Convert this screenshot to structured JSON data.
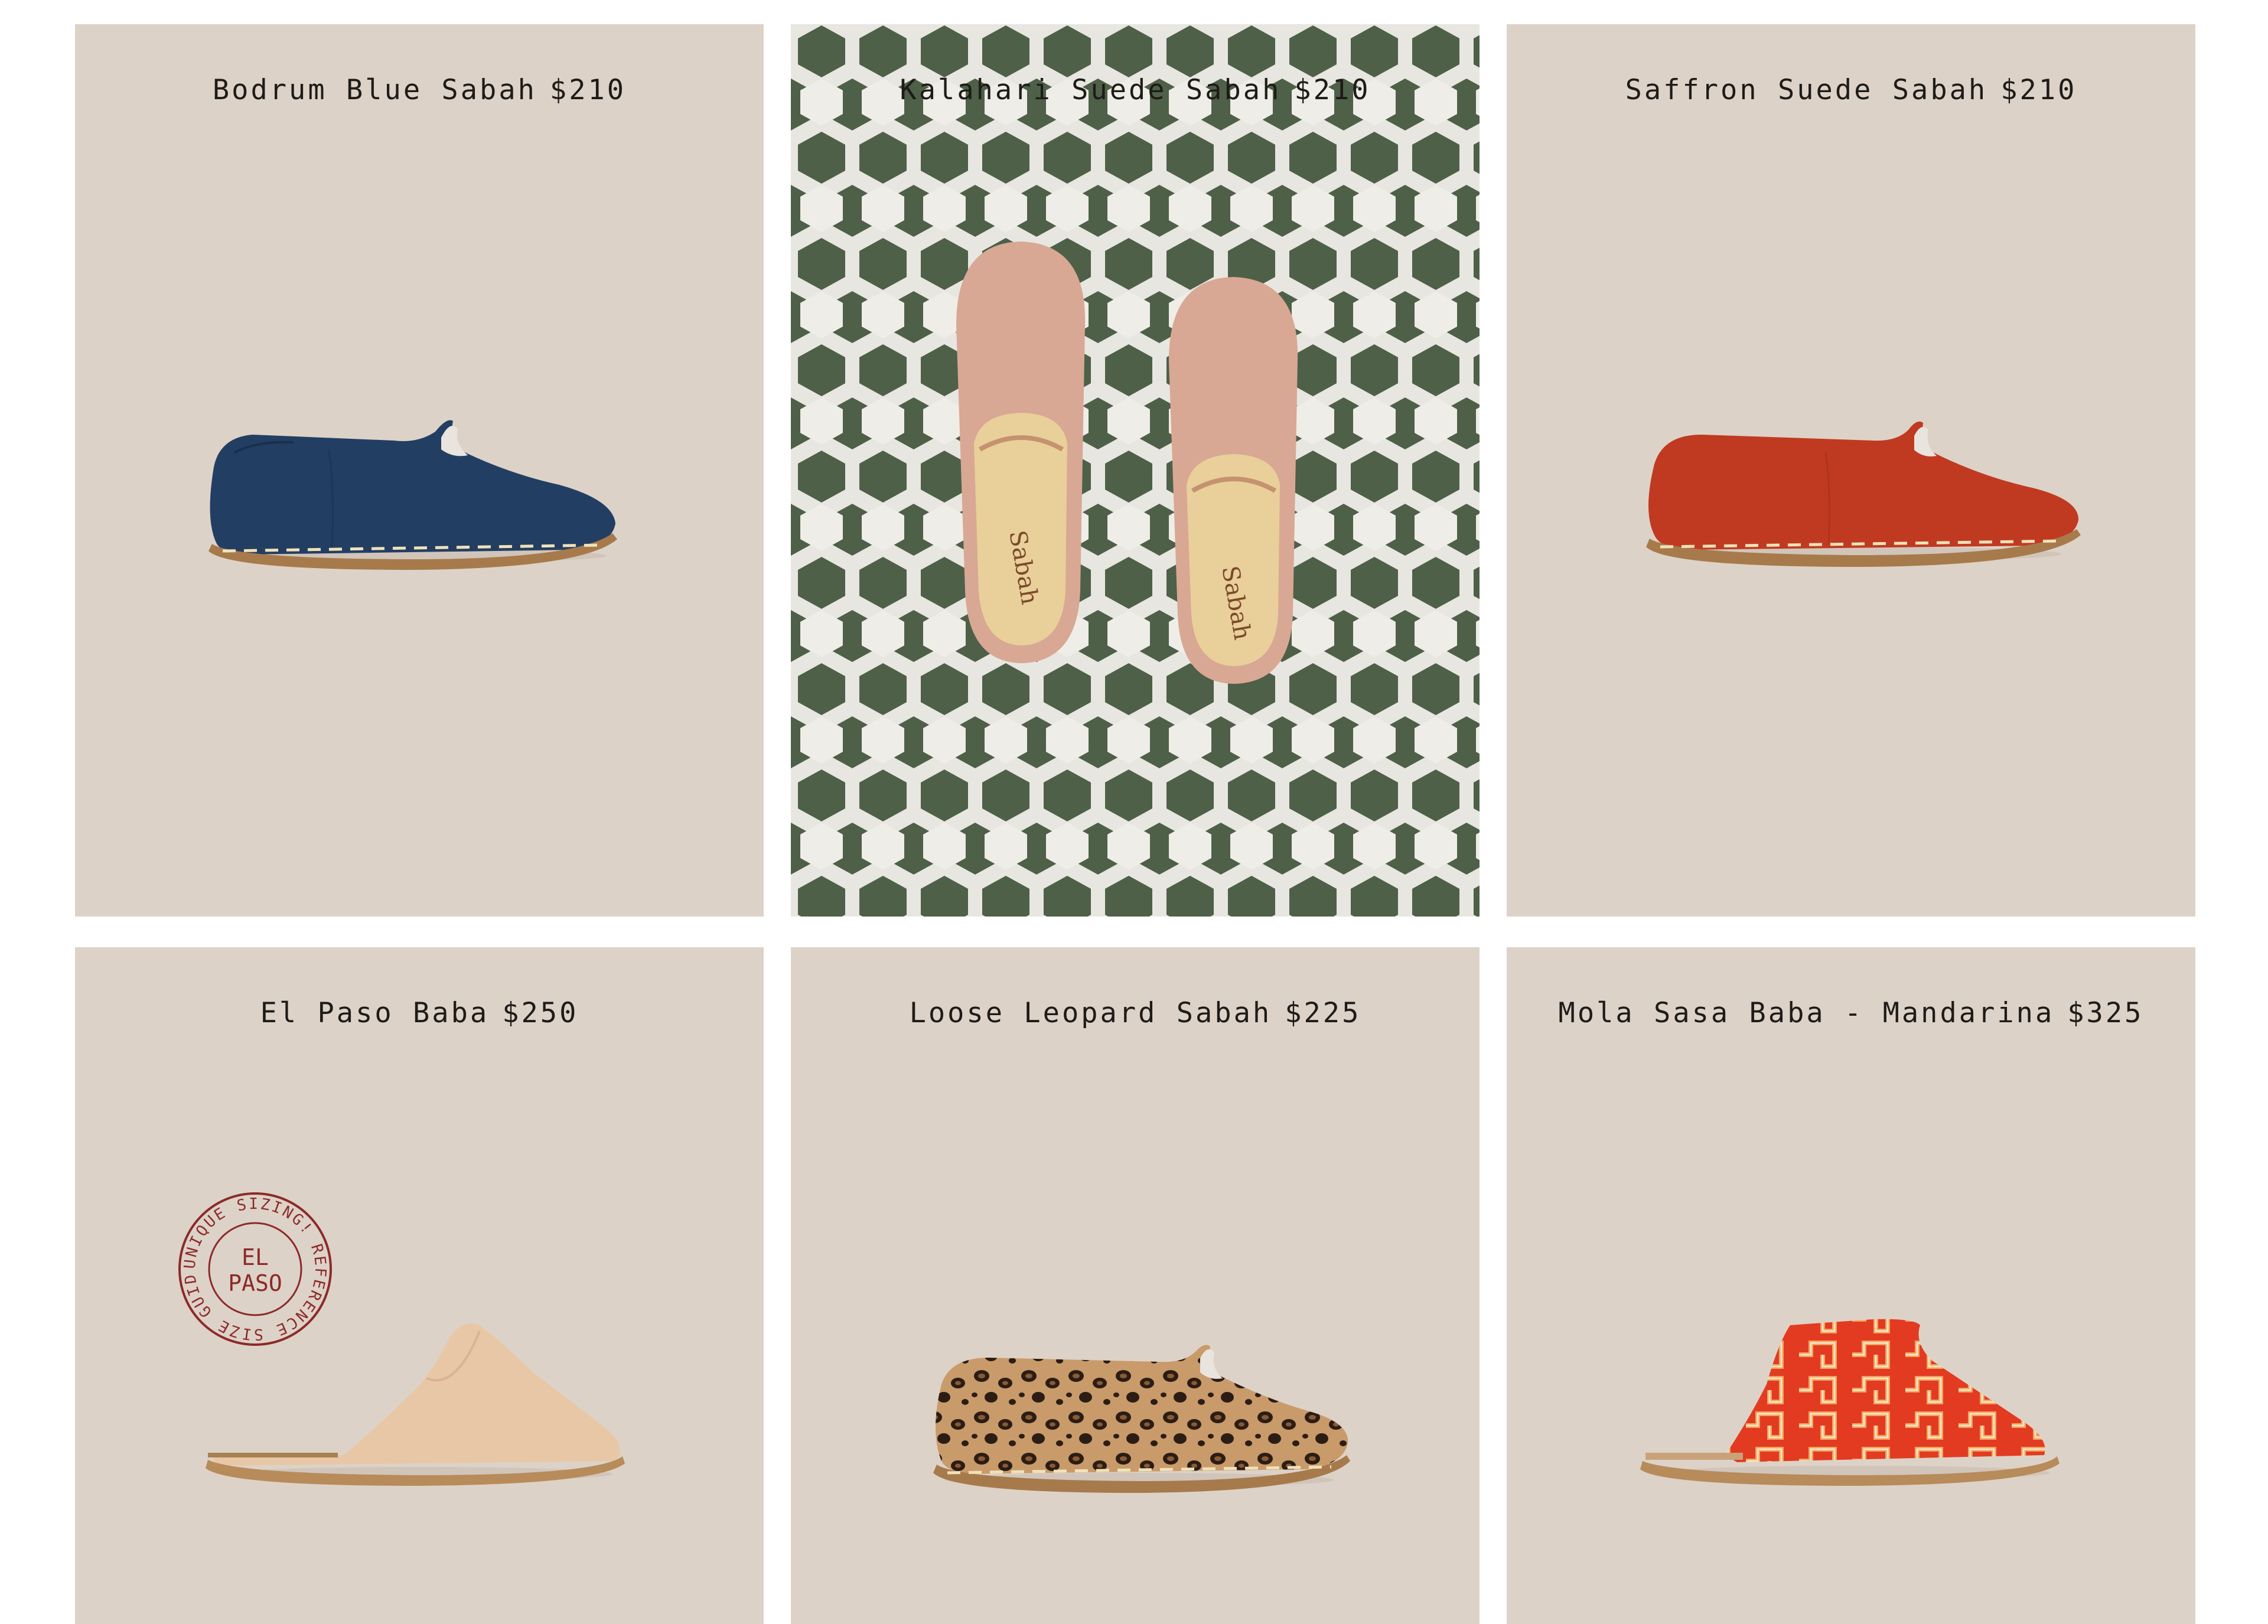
{
  "products": [
    {
      "name": "Bodrum Blue Sabah",
      "price": "$210"
    },
    {
      "name": "Kalahari Suede Sabah",
      "price": "$210"
    },
    {
      "name": "Saffron Suede Sabah",
      "price": "$210"
    },
    {
      "name": "El Paso Baba",
      "price": "$250"
    },
    {
      "name": "Loose Leopard Sabah",
      "price": "$225"
    },
    {
      "name": "Mola Sasa Baba - Mandarina",
      "price": "$325"
    }
  ],
  "stamp": {
    "center": "EL\nPASO",
    "ring": "UNIQUE SIZING! REFERENCE SIZE GUIDE"
  },
  "colors": {
    "card_bg": "#ddd2c7",
    "tile_green": "#4e6048",
    "tile_white": "#e8e6e0",
    "blue_suede": "#233e63",
    "saffron_suede": "#c03a21",
    "nude_leather": "#e8c7a7",
    "stamp_red": "#8c2a2a"
  }
}
